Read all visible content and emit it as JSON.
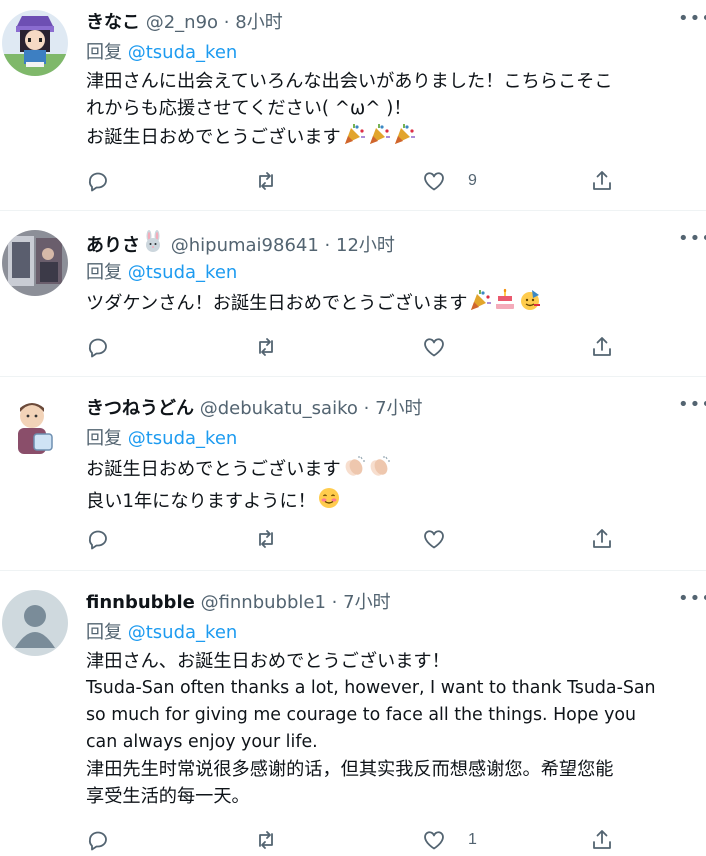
{
  "tweets": [
    {
      "name": "きなこ",
      "handle": "@2_n9o",
      "time": "8小时",
      "reply_prefix": "回复",
      "reply_to": "@tsuda_ken",
      "lines": [
        "津田さんに出会えていろんな出会いがありました！こちらこそこ",
        "れからも応援させてください( ^ω^ )！",
        "お誕生日おめでとうございます"
      ],
      "line_emojis": [
        [],
        [],
        [
          "party-popper",
          "party-popper",
          "party-popper"
        ]
      ],
      "likes": "9",
      "avatar": "anime-character"
    },
    {
      "name": "ありさ",
      "name_emoji": "rabbit-face",
      "handle": "@hipumai98641",
      "time": "12小时",
      "reply_prefix": "回复",
      "reply_to": "@tsuda_ken",
      "lines": [
        "ツダケンさん！お誕生日おめでとうございます"
      ],
      "line_emojis": [
        [
          "party-popper",
          "birthday-cake",
          "partying-face"
        ]
      ],
      "likes": "",
      "avatar": "photo"
    },
    {
      "name": "きつねうどん",
      "handle": "@debukatu_saiko",
      "time": "7小时",
      "reply_prefix": "回复",
      "reply_to": "@tsuda_ken",
      "lines": [
        "お誕生日おめでとうございます",
        "良い1年になりますように！"
      ],
      "line_emojis": [
        [
          "clapping-hands",
          "clapping-hands"
        ],
        [
          "smiling-face-blush"
        ]
      ],
      "likes": "",
      "avatar": "illustrated-person"
    },
    {
      "name": "finnbubble",
      "handle": "@finnbubble1",
      "time": "7小时",
      "reply_prefix": "回复",
      "reply_to": "@tsuda_ken",
      "lines": [
        "津田さん、お誕生日おめでとうございます！",
        "Tsuda-San often thanks a lot, however, I want to thank Tsuda-San",
        "so much for giving me courage to face all the things. Hope you",
        "can always enjoy your life.",
        "津田先生时常说很多感谢的话，但其实我反而想感谢您。希望您能",
        "享受生活的每一天。"
      ],
      "line_emojis": [
        [],
        [],
        [],
        [],
        [],
        []
      ],
      "likes": "1",
      "avatar": "default-profile"
    }
  ],
  "separator": "·",
  "more_label": "•••",
  "icons": [
    "reply-icon",
    "retweet-icon",
    "like-icon",
    "share-icon",
    "more-icon"
  ],
  "colors": {
    "link": "#1d9bf0",
    "secondary": "#536471",
    "text": "#0f1419"
  }
}
